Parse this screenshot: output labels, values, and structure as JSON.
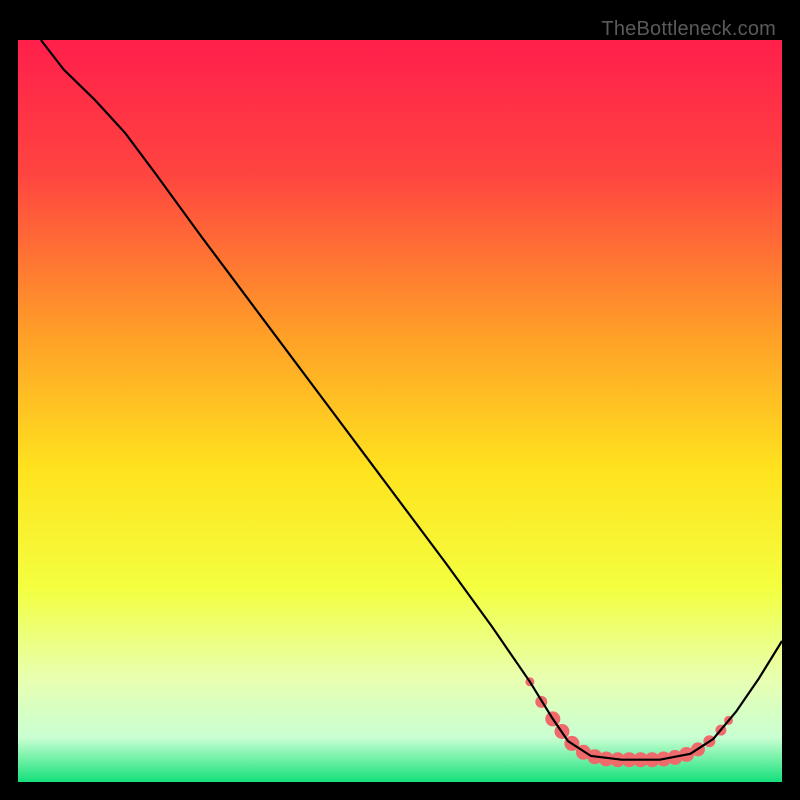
{
  "watermark": "TheBottleneck.com",
  "chart_data": {
    "type": "line",
    "title": "",
    "xlabel": "",
    "ylabel": "",
    "xlim": [
      0,
      100
    ],
    "ylim": [
      0,
      100
    ],
    "gradient_stops": [
      {
        "offset": 0,
        "color": "#ff1f4b"
      },
      {
        "offset": 18,
        "color": "#ff4440"
      },
      {
        "offset": 40,
        "color": "#ffa027"
      },
      {
        "offset": 58,
        "color": "#ffe31e"
      },
      {
        "offset": 74,
        "color": "#f3ff40"
      },
      {
        "offset": 86,
        "color": "#e8ffb0"
      },
      {
        "offset": 94,
        "color": "#c9ffd2"
      },
      {
        "offset": 100,
        "color": "#14e07a"
      }
    ],
    "series": [
      {
        "name": "bottleneck-curve",
        "stroke": "#000000",
        "points": [
          {
            "x": 3.0,
            "y": 100.0
          },
          {
            "x": 6.0,
            "y": 96.0
          },
          {
            "x": 10.0,
            "y": 92.0
          },
          {
            "x": 14.0,
            "y": 87.5
          },
          {
            "x": 18.0,
            "y": 82.0
          },
          {
            "x": 24.0,
            "y": 73.5
          },
          {
            "x": 32.0,
            "y": 62.5
          },
          {
            "x": 40.0,
            "y": 51.5
          },
          {
            "x": 48.0,
            "y": 40.5
          },
          {
            "x": 56.0,
            "y": 29.5
          },
          {
            "x": 62.0,
            "y": 21.0
          },
          {
            "x": 67.0,
            "y": 13.5
          },
          {
            "x": 70.0,
            "y": 8.5
          },
          {
            "x": 72.0,
            "y": 5.5
          },
          {
            "x": 75.0,
            "y": 3.5
          },
          {
            "x": 79.0,
            "y": 3.0
          },
          {
            "x": 84.0,
            "y": 3.0
          },
          {
            "x": 88.0,
            "y": 3.8
          },
          {
            "x": 91.0,
            "y": 5.8
          },
          {
            "x": 94.0,
            "y": 9.5
          },
          {
            "x": 97.0,
            "y": 14.0
          },
          {
            "x": 100.0,
            "y": 19.0
          }
        ]
      }
    ],
    "markers": {
      "name": "fit-band",
      "fill": "#ef6b6b",
      "stroke": "#d84a4a",
      "points": [
        {
          "x": 67.0,
          "y": 13.5,
          "r": 4.5
        },
        {
          "x": 68.5,
          "y": 10.8,
          "r": 6.0
        },
        {
          "x": 70.0,
          "y": 8.5,
          "r": 7.5
        },
        {
          "x": 71.2,
          "y": 6.8,
          "r": 7.5
        },
        {
          "x": 72.5,
          "y": 5.2,
          "r": 7.5
        },
        {
          "x": 74.0,
          "y": 4.0,
          "r": 7.5
        },
        {
          "x": 75.5,
          "y": 3.4,
          "r": 7.5
        },
        {
          "x": 77.0,
          "y": 3.1,
          "r": 7.5
        },
        {
          "x": 78.5,
          "y": 3.0,
          "r": 7.5
        },
        {
          "x": 80.0,
          "y": 3.0,
          "r": 7.5
        },
        {
          "x": 81.5,
          "y": 3.0,
          "r": 7.5
        },
        {
          "x": 83.0,
          "y": 3.0,
          "r": 7.5
        },
        {
          "x": 84.5,
          "y": 3.1,
          "r": 7.5
        },
        {
          "x": 86.0,
          "y": 3.3,
          "r": 7.5
        },
        {
          "x": 87.5,
          "y": 3.7,
          "r": 7.5
        },
        {
          "x": 89.0,
          "y": 4.4,
          "r": 7.0
        },
        {
          "x": 90.5,
          "y": 5.5,
          "r": 6.0
        },
        {
          "x": 92.0,
          "y": 7.0,
          "r": 5.5
        },
        {
          "x": 93.0,
          "y": 8.3,
          "r": 4.5
        }
      ]
    }
  }
}
